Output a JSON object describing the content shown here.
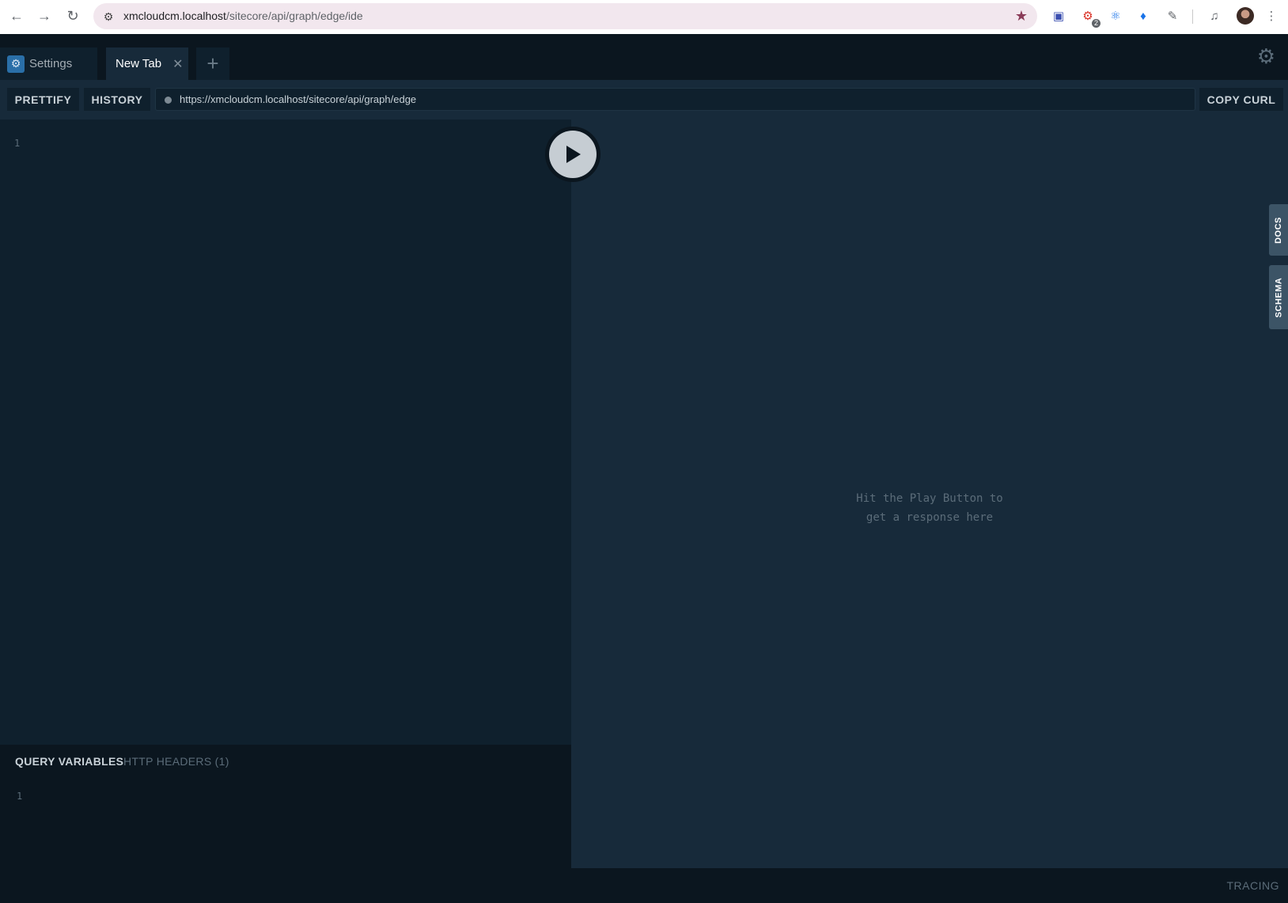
{
  "browser": {
    "url_host": "xmcloudcm.localhost",
    "url_path": "/sitecore/api/graph/edge/ide",
    "extension_badge": "2"
  },
  "tabs": [
    {
      "label": "Settings"
    },
    {
      "label": "New Tab"
    }
  ],
  "toolbar": {
    "prettify_label": "PRETTIFY",
    "history_label": "HISTORY",
    "endpoint_url": "https://xmcloudcm.localhost/sitecore/api/graph/edge",
    "copy_curl_label": "COPY CURL"
  },
  "query_editor": {
    "line_number": "1"
  },
  "response": {
    "hint_line1": "Hit the Play Button to",
    "hint_line2": "get a response here"
  },
  "variables": {
    "tab_query_variables": "QUERY VARIABLES",
    "tab_http_headers": "HTTP HEADERS (1)",
    "line_number": "1"
  },
  "side_tabs": {
    "docs": "DOCS",
    "schema": "SCHEMA"
  },
  "footer": {
    "tracing_label": "TRACING"
  },
  "colors": {
    "accent": "#2a6fa8",
    "panel_dark": "#0b161f",
    "panel": "#0f202d",
    "panel_light": "#172a3a"
  }
}
